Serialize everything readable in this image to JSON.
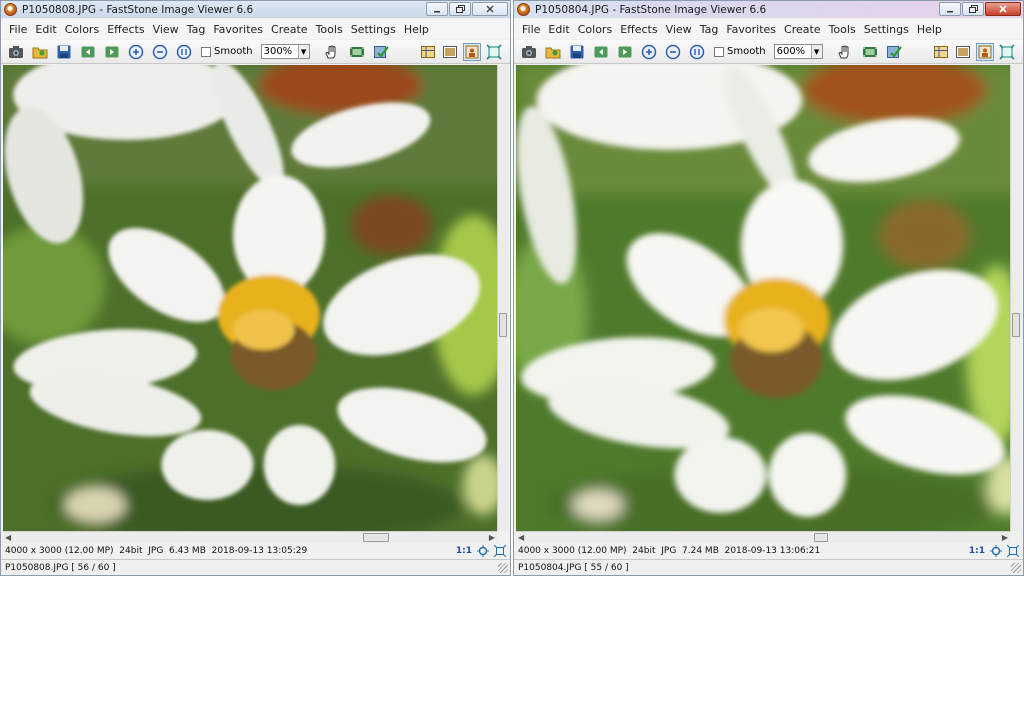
{
  "colors": {
    "titlebar": "#c9d8ea",
    "window_border": "#8a9bb0",
    "foliage": "#4a6b2a",
    "petal": "#f2f2ee",
    "flower_center": "#e8b21c",
    "orange_flower": "#b8561a"
  },
  "icons": [
    "camera-icon",
    "open-folder-icon",
    "save-icon",
    "previous-icon",
    "next-icon",
    "zoom-in-icon",
    "zoom-out-icon",
    "actual-size-icon",
    "hand-icon",
    "filmstrip-icon",
    "check-icon",
    "layout-icon",
    "compare-icon",
    "fullscreen-icon",
    "fit-icon"
  ],
  "windows": {
    "left": {
      "title": "P1050808.JPG  -  FastStone Image Viewer 6.6",
      "menu": [
        "File",
        "Edit",
        "Colors",
        "Effects",
        "View",
        "Tag",
        "Favorites",
        "Create",
        "Tools",
        "Settings",
        "Help"
      ],
      "smooth_label": "Smooth",
      "zoom": "300%",
      "info": {
        "dimensions": "4000 x 3000 (12.00 MP)",
        "bit_depth": "24bit",
        "format": "JPG",
        "size": "6.43 MB",
        "date": "2018-09-13 13:05:29",
        "ratio": "1:1"
      },
      "status": "P1050808.JPG [ 56 / 60 ]"
    },
    "right": {
      "title": "P1050804.JPG  -  FastStone Image Viewer 6.6",
      "menu": [
        "File",
        "Edit",
        "Colors",
        "Effects",
        "View",
        "Tag",
        "Favorites",
        "Create",
        "Tools",
        "Settings",
        "Help"
      ],
      "smooth_label": "Smooth",
      "zoom": "600%",
      "info": {
        "dimensions": "4000 x 3000 (12.00 MP)",
        "bit_depth": "24bit",
        "format": "JPG",
        "size": "7.24 MB",
        "date": "2018-09-13 13:06:21",
        "ratio": "1:1"
      },
      "status": "P1050804.JPG [ 55 / 60 ]"
    }
  }
}
